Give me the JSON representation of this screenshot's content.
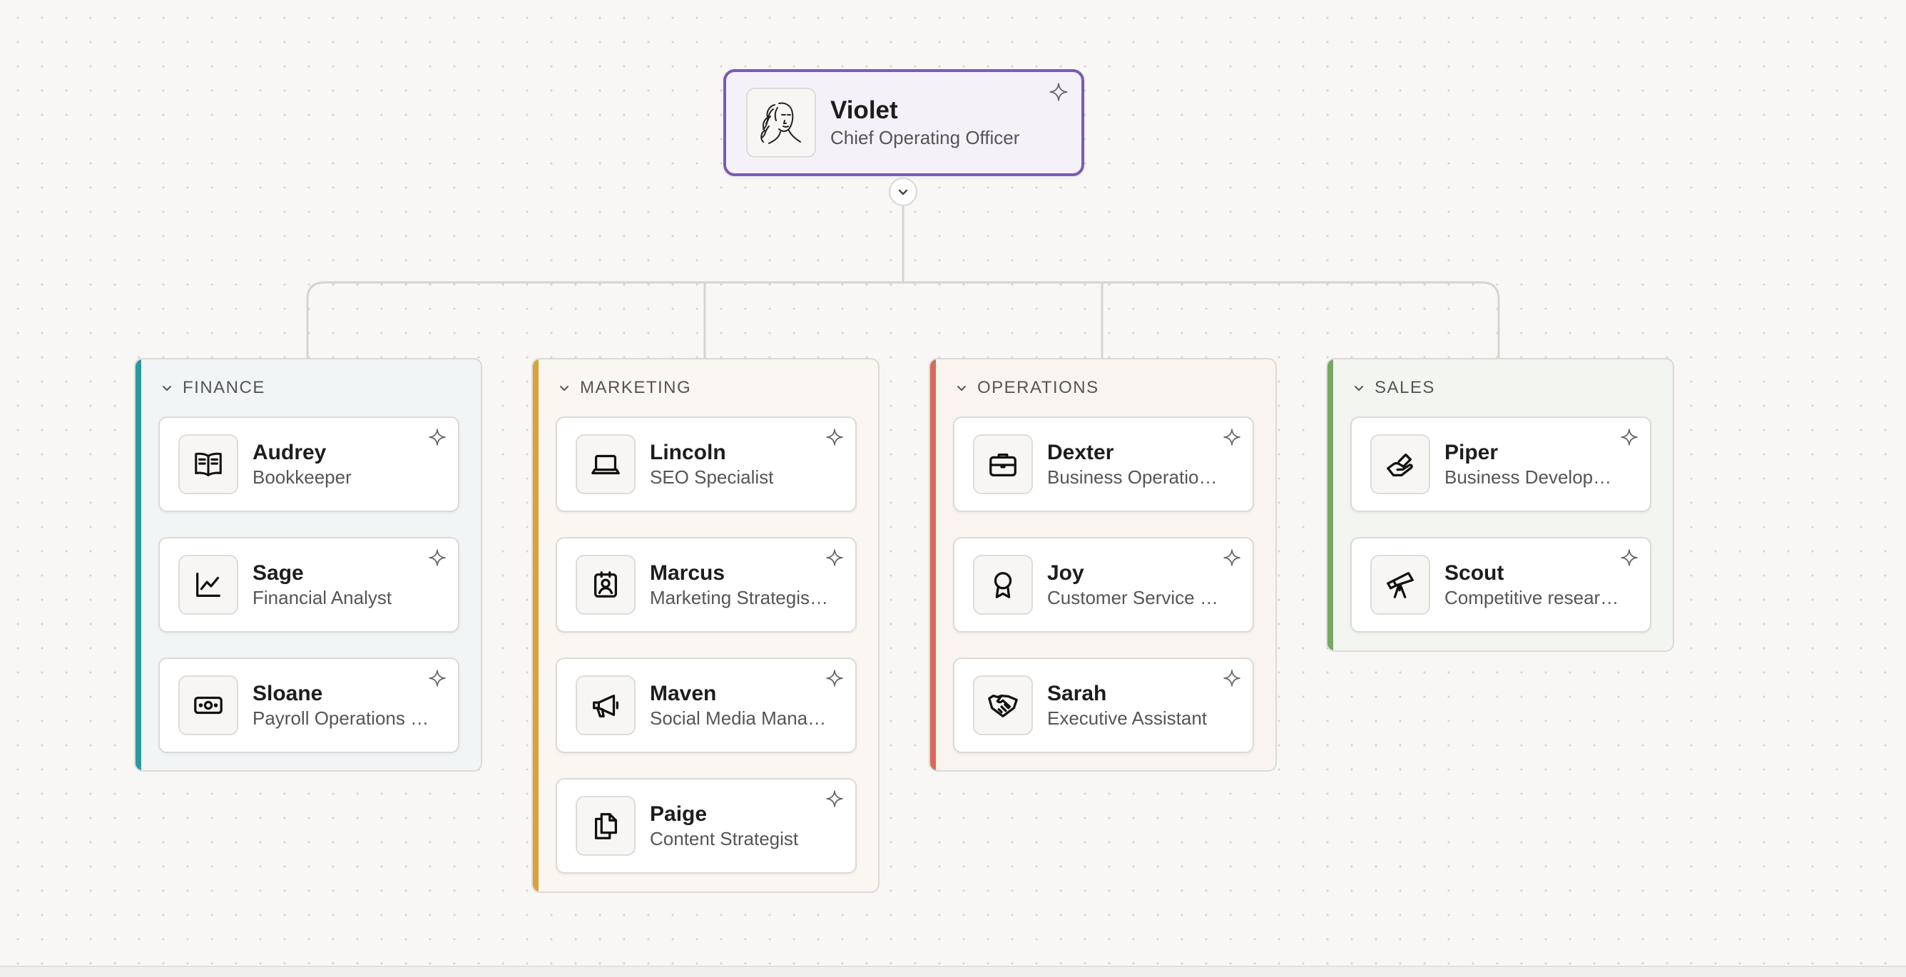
{
  "root": {
    "name": "Violet",
    "role": "Chief Operating Officer",
    "avatar": "woman-portrait-sketch"
  },
  "icons": {
    "pin": "sparkle-icon",
    "collapse": "chevron-down-icon"
  },
  "departments": [
    {
      "title": "FINANCE",
      "accent": "#2a9a9c",
      "members": [
        {
          "name": "Audrey",
          "role": "Bookkeeper",
          "icon": "open-book-icon"
        },
        {
          "name": "Sage",
          "role": "Financial Analyst",
          "icon": "line-chart-icon"
        },
        {
          "name": "Sloane",
          "role": "Payroll Operations M...",
          "icon": "banknote-icon"
        }
      ]
    },
    {
      "title": "MARKETING",
      "accent": "#d9a23a",
      "members": [
        {
          "name": "Lincoln",
          "role": "SEO Specialist",
          "icon": "laptop-icon"
        },
        {
          "name": "Marcus",
          "role": "Marketing Strategist ...",
          "icon": "contact-badge-icon"
        },
        {
          "name": "Maven",
          "role": "Social Media Manager",
          "icon": "megaphone-icon"
        },
        {
          "name": "Paige",
          "role": "Content Strategist",
          "icon": "copy-documents-icon"
        }
      ]
    },
    {
      "title": "OPERATIONS",
      "accent": "#d96a5a",
      "members": [
        {
          "name": "Dexter",
          "role": "Business Operations...",
          "icon": "briefcase-icon"
        },
        {
          "name": "Joy",
          "role": "Customer Service M...",
          "icon": "award-ribbon-icon"
        },
        {
          "name": "Sarah",
          "role": "Executive Assistant",
          "icon": "handshake-icon"
        }
      ]
    },
    {
      "title": "SALES",
      "accent": "#75a863",
      "members": [
        {
          "name": "Piper",
          "role": "Business Developm...",
          "icon": "hand-coins-icon"
        },
        {
          "name": "Scout",
          "role": "Competitive researc...",
          "icon": "telescope-icon"
        }
      ]
    }
  ]
}
